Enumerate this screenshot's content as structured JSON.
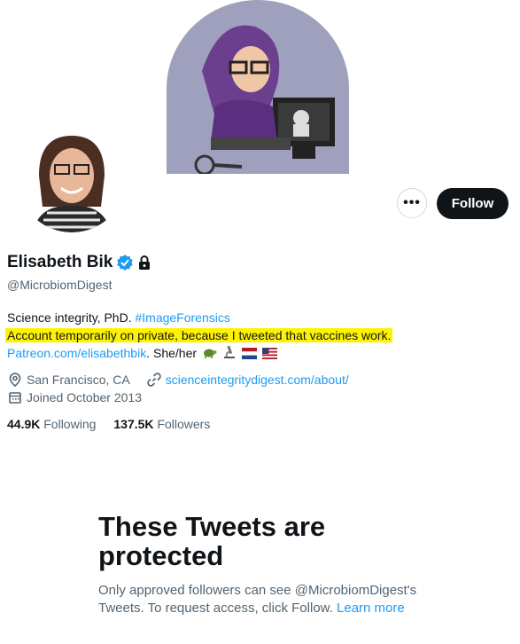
{
  "profile": {
    "display_name": "Elisabeth Bik",
    "handle": "@MicrobiomDigest",
    "bio_line1_text": "Science integrity, PhD. ",
    "bio_line1_hashtag": "#ImageForensics",
    "bio_line2_highlight": "Account temporarily on private, because I tweeted that vaccines work.",
    "bio_line3_link": "Patreon.com/elisabethbik",
    "bio_line3_text": ". She/her",
    "bio_emojis": [
      "turtle-emoji",
      "microscope-emoji",
      "netherlands-flag-emoji",
      "us-flag-emoji"
    ],
    "location": "San Francisco, CA",
    "website": "scienceintegritydigest.com/about/",
    "joined": "Joined October 2013"
  },
  "stats": {
    "following_count": "44.9K",
    "following_label": "Following",
    "followers_count": "137.5K",
    "followers_label": "Followers"
  },
  "actions": {
    "more_label": "•••",
    "follow_label": "Follow"
  },
  "protected": {
    "title": "These Tweets are protected",
    "body": "Only approved followers can see @MicrobiomDigest's Tweets. To request access, click Follow.",
    "learn_more": "Learn more"
  },
  "colors": {
    "accent": "#1d9bf0",
    "highlight": "#fff200",
    "follow_button": "#0f1419",
    "secondary_text": "#536471"
  }
}
